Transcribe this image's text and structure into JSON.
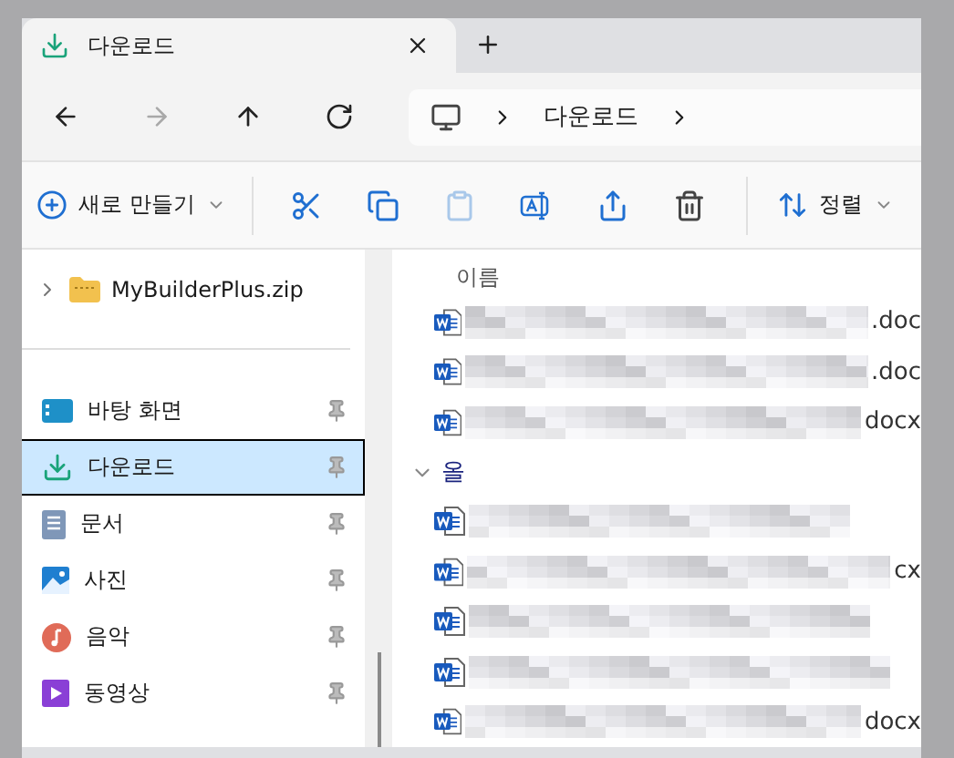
{
  "tab": {
    "title": "다운로드",
    "selected": true
  },
  "nav": [
    {
      "kind": "back",
      "disabled": false
    },
    {
      "kind": "forward",
      "disabled": true
    },
    {
      "kind": "up",
      "disabled": false
    },
    {
      "kind": "refresh",
      "disabled": false
    }
  ],
  "breadcrumb": [
    "다운로드"
  ],
  "toolbar": {
    "new_label": "새로 만들기",
    "sort_label": "정렬",
    "actions": [
      {
        "kind": "cut",
        "disabled": false
      },
      {
        "kind": "copy",
        "disabled": false
      },
      {
        "kind": "paste",
        "disabled": true
      },
      {
        "kind": "rename",
        "disabled": false
      },
      {
        "kind": "share",
        "disabled": false
      },
      {
        "kind": "delete",
        "disabled": false
      }
    ]
  },
  "tree": [
    {
      "label": "MyBuilderPlus.zip",
      "kind": "zip",
      "expanded": false
    }
  ],
  "quick_access": [
    {
      "label": "바탕 화면",
      "kind": "desktop",
      "selected": false,
      "pinned": true
    },
    {
      "label": "다운로드",
      "kind": "download",
      "selected": true,
      "pinned": true
    },
    {
      "label": "문서",
      "kind": "documents",
      "selected": false,
      "pinned": true
    },
    {
      "label": "사진",
      "kind": "pictures",
      "selected": false,
      "pinned": true
    },
    {
      "label": "음악",
      "kind": "music",
      "selected": false,
      "pinned": true
    },
    {
      "label": "동영상",
      "kind": "videos",
      "selected": false,
      "pinned": true
    }
  ],
  "files": {
    "column": "이름",
    "groups": [
      {
        "rows": [
          {
            "tail": ".doc"
          },
          {
            "tail": ".doc"
          },
          {
            "tail": "docx"
          }
        ]
      },
      {
        "header": "올",
        "expanded": true,
        "rows": [
          {
            "tail": ""
          },
          {
            "tail": "cx"
          },
          {
            "tail": ""
          },
          {
            "tail": ""
          },
          {
            "tail": "docx"
          }
        ]
      }
    ]
  }
}
